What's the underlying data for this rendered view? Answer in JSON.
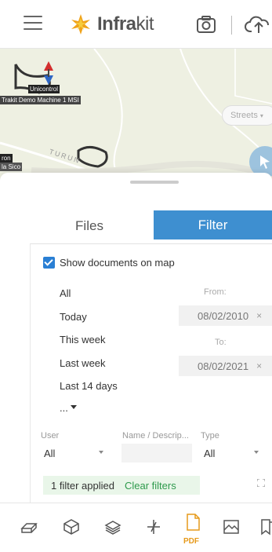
{
  "header": {
    "logo_bold": "Infra",
    "logo_regular": "kit",
    "brand_colors": {
      "flame_orange": "#f0a31b",
      "flame_yellow": "#f6cc3b"
    },
    "icons": [
      "menu-icon",
      "camera-icon",
      "cloud-upload-icon"
    ]
  },
  "map": {
    "layer_button": "Streets",
    "labels": {
      "machine_tag": "Unicontrol",
      "machine_name": "Trakit Demo Machine 1 MSI",
      "other_tag": "ron",
      "other_sub": "la Sico"
    },
    "road_name": "TURUN"
  },
  "filter_panel": {
    "tabs": {
      "files": "Files",
      "filter": "Filter"
    },
    "active_tab": "Filter",
    "show_on_map_label": "Show documents on map",
    "show_on_map_checked": true,
    "presets": [
      "All",
      "Today",
      "This week",
      "Last week",
      "Last 14 days"
    ],
    "more_label": "...",
    "from_label": "From:",
    "from_value": "08/02/2010",
    "to_label": "To:",
    "to_value": "08/02/2021",
    "clear_symbol": "×",
    "user_label": "User",
    "user_value": "All",
    "name_label": "Name / Descrip...",
    "name_value": "",
    "type_label": "Type",
    "type_value": "All",
    "filters_applied": "1 filter applied",
    "clear_filters": "Clear filters",
    "accent_color": "#3e8fd0",
    "clear_color": "#2e9a4c"
  },
  "toolbar": {
    "items": [
      "layers-icon",
      "model-box-icon",
      "stack-icon",
      "survey-point-icon",
      "pdf-file-icon",
      "image-icon",
      "bookmark-icon"
    ],
    "pdf_label": "PDF"
  }
}
